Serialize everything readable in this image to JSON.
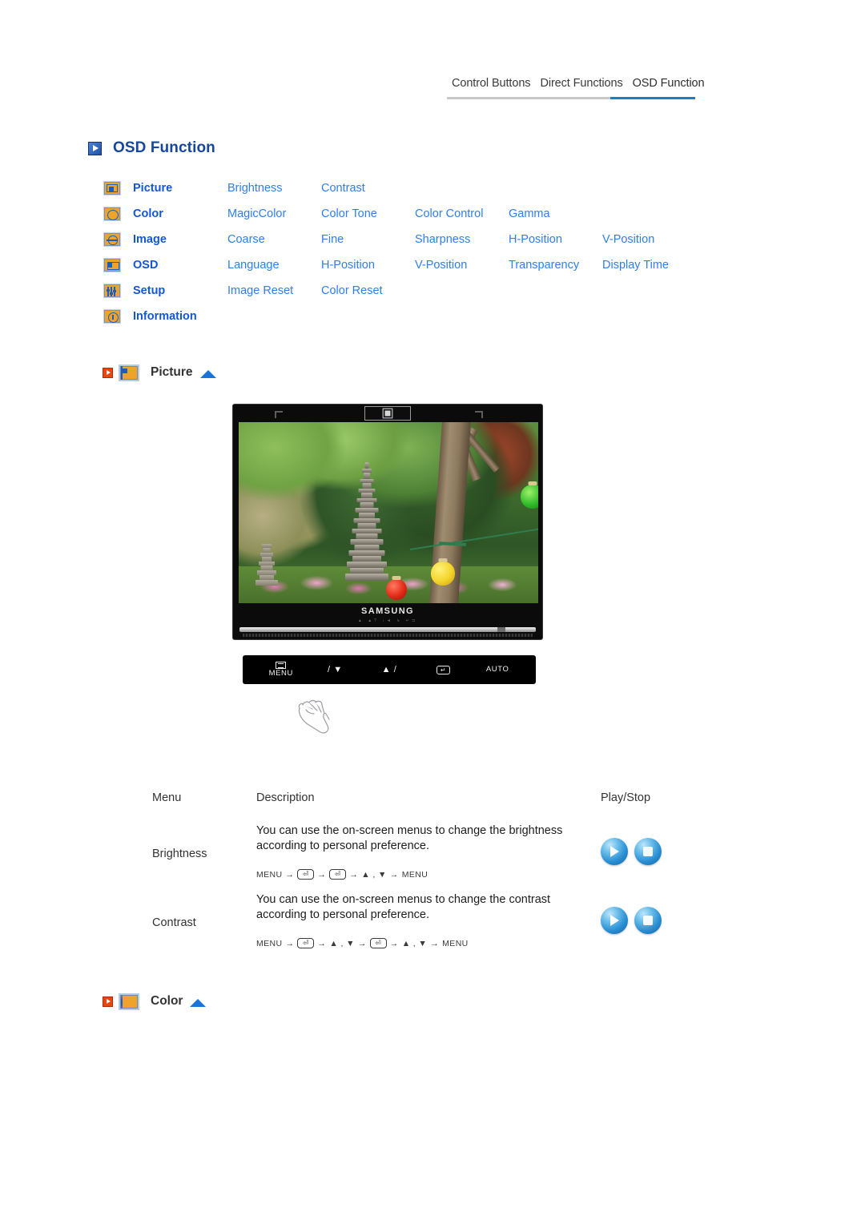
{
  "tabs": [
    {
      "label": "Control Buttons",
      "active": false
    },
    {
      "label": "Direct Functions",
      "active": false
    },
    {
      "label": "OSD Function",
      "active": true
    }
  ],
  "page_title": "OSD Function",
  "accent_colors": {
    "tab_underline": "#1b7fc3",
    "title_blue": "#16479d",
    "category_blue": "#1356d6",
    "item_blue": "#2e7ef0",
    "icon_orange": "#f0a32a",
    "red_marker": "#e8460f"
  },
  "menu_map": {
    "rows": [
      {
        "icon": "picture-icon",
        "category": "Picture",
        "items": [
          "Brightness",
          "Contrast"
        ]
      },
      {
        "icon": "color-icon",
        "category": "Color",
        "items": [
          "MagicColor",
          "Color Tone",
          "Color Control",
          "Gamma"
        ]
      },
      {
        "icon": "image-icon",
        "category": "Image",
        "items": [
          "Coarse",
          "Fine",
          "Sharpness",
          "H-Position",
          "V-Position"
        ]
      },
      {
        "icon": "osd-icon",
        "category": "OSD",
        "items": [
          "Language",
          "H-Position",
          "V-Position",
          "Transparency",
          "Display Time"
        ]
      },
      {
        "icon": "setup-icon",
        "category": "Setup",
        "items": [
          "Image Reset",
          "Color Reset"
        ]
      },
      {
        "icon": "information-icon",
        "category": "Information",
        "items": []
      }
    ]
  },
  "sections": [
    {
      "label": "Picture",
      "icon": "picture-icon"
    },
    {
      "label": "Color",
      "icon": "color-icon"
    }
  ],
  "monitor": {
    "brand": "SAMSUNG",
    "brand_sub": "▲ ▲? ↓◄ ↳ ↵⊐",
    "screen_alt": "Korean temple garden with stone pagoda, trees and paper lanterns"
  },
  "control_buttons": [
    {
      "name": "menu-button",
      "label": "MENU",
      "glyph": "menu-icon"
    },
    {
      "name": "brightness-down-button",
      "label": "",
      "glyph": "/ ▼"
    },
    {
      "name": "volume-up-button",
      "label": "",
      "glyph": "▲ /"
    },
    {
      "name": "enter-button",
      "label": "",
      "glyph": "enter-icon"
    },
    {
      "name": "auto-button",
      "label": "AUTO",
      "glyph": ""
    }
  ],
  "desc_table": {
    "headers": {
      "menu": "Menu",
      "description": "Description",
      "play_stop": "Play/Stop"
    },
    "rows": [
      {
        "menu": "Brightness",
        "description": "You can use the on-screen menus to change the brightness according to personal preference.",
        "keys": [
          "MENU",
          "→",
          "⏎",
          "→",
          "⏎",
          "→",
          "▲ , ▼",
          "→",
          "MENU"
        ],
        "play_label": "Play",
        "stop_label": "Stop"
      },
      {
        "menu": "Contrast",
        "description": "You can use the on-screen menus to change the contrast according to personal preference.",
        "keys": [
          "MENU",
          "→",
          "⏎",
          "→",
          "▲ , ▼",
          "→",
          "⏎",
          "→",
          "▲ , ▼",
          "→",
          "MENU"
        ],
        "play_label": "Play",
        "stop_label": "Stop"
      }
    ]
  }
}
